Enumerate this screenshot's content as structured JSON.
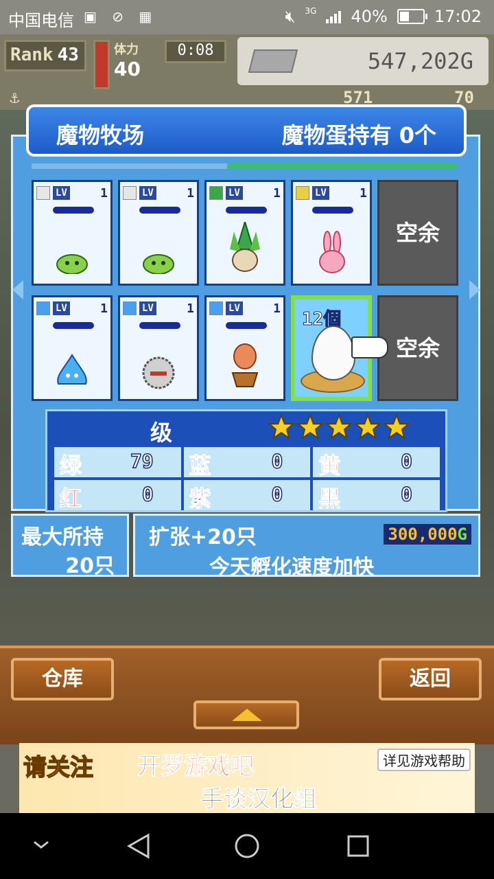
{
  "status": {
    "carrier": "中国电信",
    "network": "3G",
    "battery_pct": "40%",
    "battery_level": 0.4,
    "time": "17:02"
  },
  "hud": {
    "rank_label": "Rank",
    "rank_value": "43",
    "stamina_label": "体力",
    "stamina_value": "40",
    "timer": "0:08",
    "gold": "547,202G",
    "secondary_left": "",
    "secondary_mid": "571",
    "secondary_right": "70"
  },
  "ranch": {
    "title": "魔物牧场",
    "egg_status": "魔物蛋持有  0个",
    "progress": 0.54,
    "slots": [
      {
        "element": "white",
        "lv_tag": "LV",
        "level": "1",
        "monster": "green-slime"
      },
      {
        "element": "white",
        "lv_tag": "LV",
        "level": "1",
        "monster": "green-slime"
      },
      {
        "element": "green",
        "lv_tag": "LV",
        "level": "1",
        "monster": "leaf-sprout"
      },
      {
        "element": "yellow",
        "lv_tag": "LV",
        "level": "1",
        "monster": "pink-rabbit"
      },
      {
        "element": "blue",
        "lv_tag": "LV",
        "level": "1",
        "monster": "blue-slime"
      },
      {
        "element": "blue",
        "lv_tag": "LV",
        "level": "1",
        "monster": "fuzzball"
      },
      {
        "element": "blue",
        "lv_tag": "LV",
        "level": "1",
        "monster": "octopus-pot"
      }
    ],
    "empty_label": "空余",
    "egg_count": "12個"
  },
  "level": {
    "title": "级",
    "stars": 5,
    "stats": [
      {
        "label": "绿",
        "value": "79",
        "color": "#2fbf2f"
      },
      {
        "label": "蓝",
        "value": "0",
        "color": "#2a4ad8"
      },
      {
        "label": "黄",
        "value": "0",
        "color": "#e06a10"
      },
      {
        "label": "红",
        "value": "0",
        "color": "#e02a2a"
      },
      {
        "label": "紫",
        "value": "0",
        "color": "#8a2ab8"
      },
      {
        "label": "黑",
        "value": "0",
        "color": "#222222"
      }
    ]
  },
  "capacity": {
    "label": "最大所持",
    "value": "20只"
  },
  "expand": {
    "label": "扩张+20只",
    "price": "300,000",
    "currency": "G",
    "notice": "今天孵化速度加快"
  },
  "buttons": {
    "warehouse": "仓库",
    "back": "返回"
  },
  "ad": {
    "line1": "请关注",
    "line2": "开罗游戏吧",
    "line3": "手谈汉化组",
    "help": "详见游戏帮助"
  },
  "colors": {
    "panel": "#4f9fe0",
    "title_bg": "#1d5cc8",
    "wood": "#8a4c18"
  }
}
